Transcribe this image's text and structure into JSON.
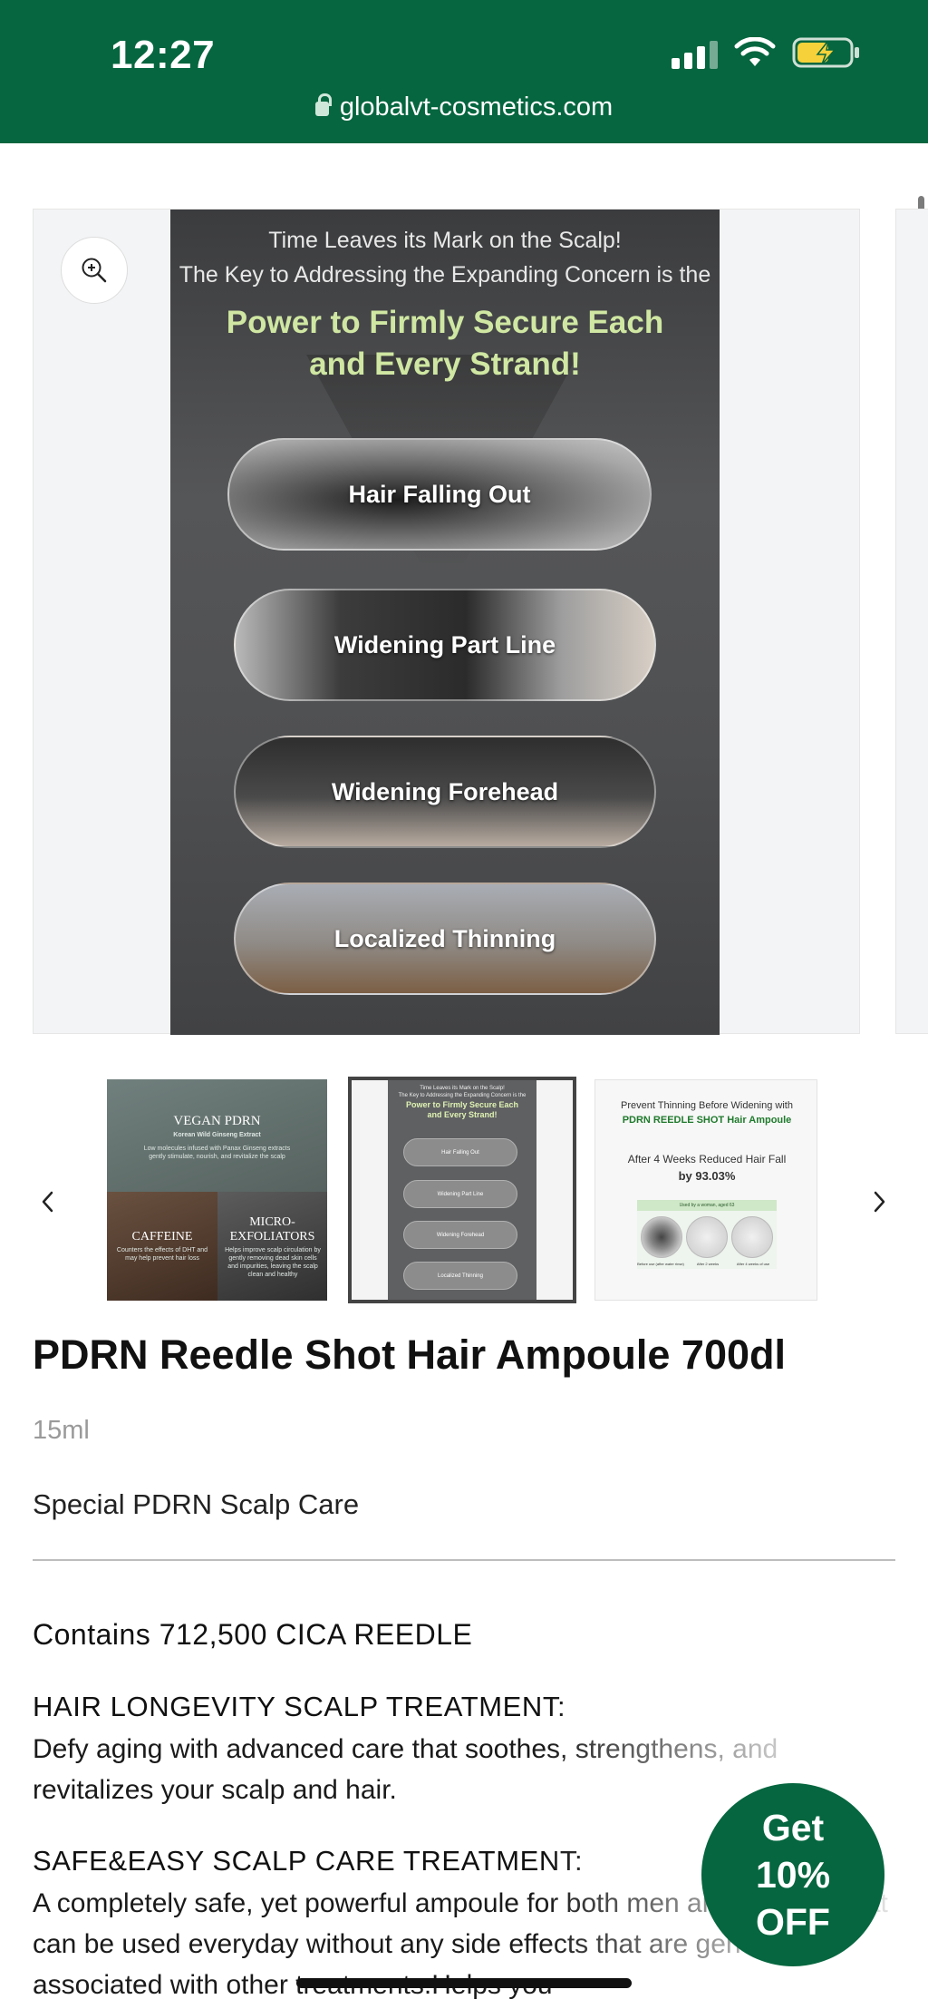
{
  "status_bar": {
    "time": "12:27",
    "url": "globalvt-cosmetics.com",
    "bg_color": "#05663f",
    "battery_color": "#f7d13a"
  },
  "gallery": {
    "zoom_icon": "zoom-in-icon",
    "poster": {
      "line1": "Time Leaves its Mark on the Scalp!",
      "line2": "The Key to Addressing the Expanding Concern is the",
      "headline1": "Power to Firmly Secure Each",
      "headline2": "and Every Strand!",
      "items": [
        "Hair Falling Out",
        "Widening Part Line",
        "Widening Forehead",
        "Localized Thinning"
      ]
    }
  },
  "thumbnails": {
    "prev_icon": "chevron-left-icon",
    "next_icon": "chevron-right-icon",
    "t1": {
      "vegan_title": "VEGAN PDRN",
      "vegan_sub": "Korean Wild Ginseng Extract",
      "vegan_desc": "Low molecules infused with Panax Ginseng extracts gently stimulate, nourish, and revitalize the scalp",
      "caffeine_title": "CAFFEINE",
      "caffeine_desc": "Counters the effects of DHT and may help prevent hair loss",
      "micro_title": "MICRO-",
      "micro_title2": "EXFOLIATORS",
      "micro_desc": "Helps improve scalp circulation by gently removing dead skin cells and impurities, leaving the scalp clean and healthy"
    },
    "t2": {
      "line1": "Time Leaves its Mark on the Scalp!",
      "line2": "The Key to Addressing the Expanding Concern is the",
      "head1": "Power to Firmly Secure Each",
      "head2": "and Every Strand!",
      "items": [
        "Hair Falling Out",
        "Widening Part Line",
        "Widening Forehead",
        "Localized Thinning"
      ]
    },
    "t3": {
      "line1": "Prevent Thinning Before Widening with",
      "line2": "PDRN REEDLE SHOT Hair Ampoule",
      "line3": "After 4 Weeks Reduced Hair Fall",
      "line4": "by 93.03%",
      "band": "Used by a woman, aged 63",
      "captions": [
        "Before use (after water rinse)",
        "After 2 weeks",
        "After 4 weeks of use"
      ]
    }
  },
  "product": {
    "title": "PDRN Reedle Shot Hair Ampoule 700dl",
    "size": "15ml",
    "subtitle": "Special PDRN Scalp Care",
    "contains": "Contains 712,500 CICA REEDLE",
    "sections": [
      {
        "heading": "HAIR LONGEVITY SCALP TREATMENT:",
        "body": "Defy aging with advanced care that soothes, strengthens, and revitalizes your scalp and hair."
      },
      {
        "heading": "SAFE&EASY SCALP CARE TREATMENT:",
        "body": "A completely safe, yet powerful ampoule for both men and women, that can be used everyday without any side effects that are generally associated with other treatments.Helps you"
      }
    ]
  },
  "promo": {
    "line1": "Get",
    "line2": "10%",
    "line3": "OFF"
  }
}
